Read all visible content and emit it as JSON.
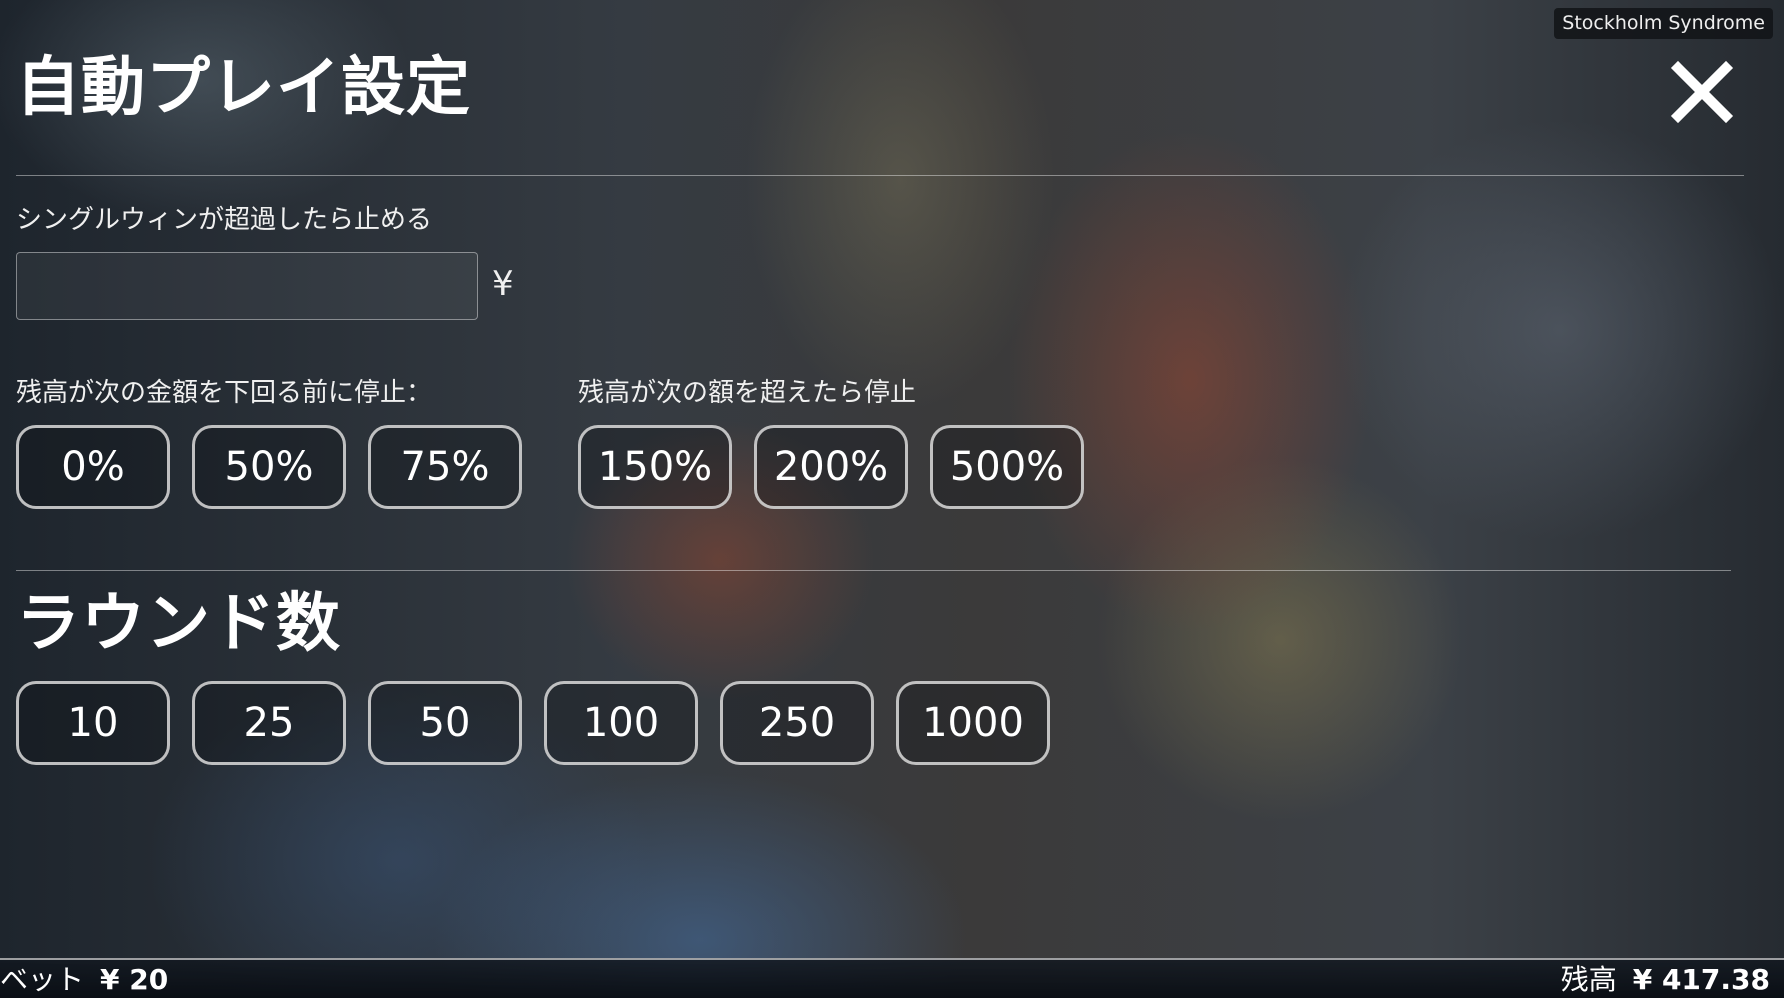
{
  "game_name": "Stockholm Syndrome",
  "title": "自動プレイ設定",
  "close_icon": "close-icon",
  "single_win": {
    "label": "シングルウィンが超過したら止める",
    "value": "",
    "placeholder": "",
    "currency": "¥"
  },
  "stop_if_balance_decreases": {
    "label": "残高が次の金額を下回る前に停止：",
    "options": [
      "0%",
      "50%",
      "75%"
    ]
  },
  "stop_if_balance_increases": {
    "label": "残高が次の額を超えたら停止",
    "options": [
      "150%",
      "200%",
      "500%"
    ]
  },
  "rounds": {
    "title": "ラウンド数",
    "options": [
      "10",
      "25",
      "50",
      "100",
      "250",
      "1000"
    ]
  },
  "footer": {
    "bet_label": "ベット",
    "bet_value": "¥ 20",
    "balance_label": "残高",
    "balance_value": "¥ 417.38"
  },
  "colors": {
    "pill_border": "#dcdcdc",
    "text": "#ffffff",
    "badge_bg": "#121418"
  }
}
